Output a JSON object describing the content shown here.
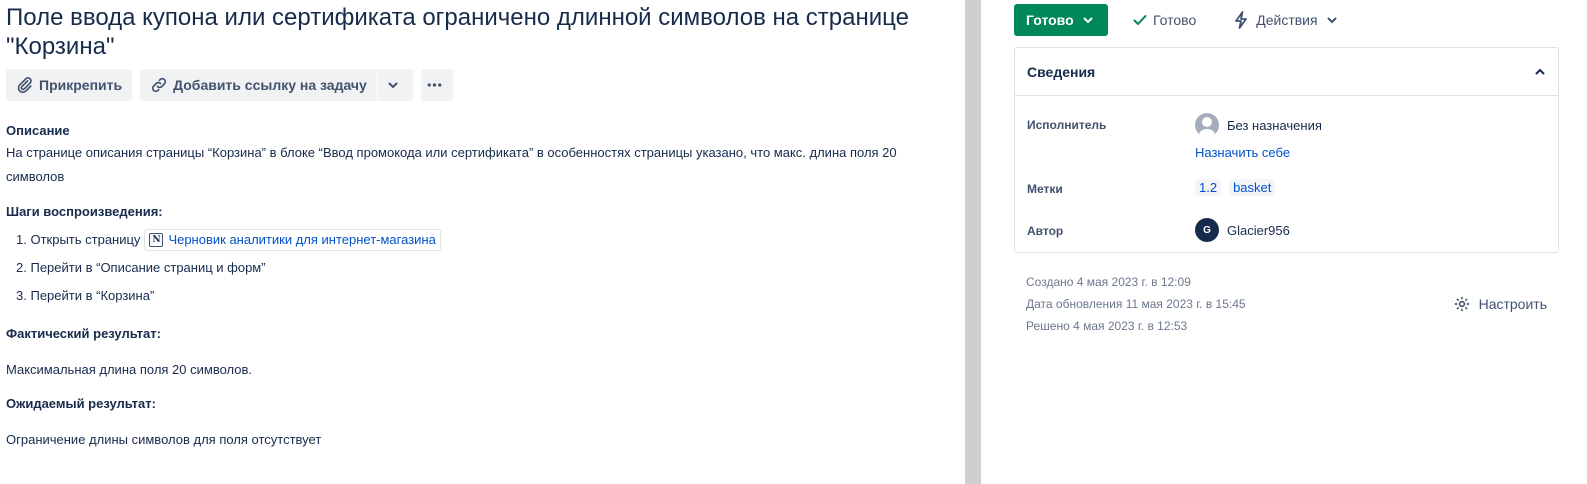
{
  "issue": {
    "title": "Поле ввода купона или сертификата ограничено длинной символов на странице \"Корзина\""
  },
  "toolbar": {
    "attach_label": "Прикрепить",
    "link_issue_label": "Добавить ссылку на задачу",
    "more_icon": "more-icon"
  },
  "description": {
    "label": "Описание",
    "text": "На странице описания страницы “Корзина” в блоке “Ввод промокода или сертификата” в особенностях страницы указано, что макс. длина поля 20 символов",
    "steps_heading": "Шаги воспроизведения:",
    "steps": [
      {
        "num": "1.",
        "text": "Открыть страницу",
        "link": "Черновик аналитики для интернет-магазина"
      },
      {
        "num": "2.",
        "text": "Перейти в “Описание страниц и форм”"
      },
      {
        "num": "3.",
        "text": "Перейти в “Корзина”"
      }
    ],
    "actual_heading": "Фактический результат:",
    "actual_text": "Максимальная длина поля 20 символов.",
    "expected_heading": "Ожидаемый результат:",
    "expected_text": "Ограничение длины символов для поля отсутствует"
  },
  "status": {
    "button_label": "Готово",
    "resolution_label": "Готово",
    "actions_label": "Действия",
    "accent_color": "#00875a"
  },
  "details": {
    "title": "Сведения",
    "assignee_label": "Исполнитель",
    "assignee_value": "Без назначения",
    "assign_me": "Назначить себе",
    "labels_label": "Метки",
    "labels": [
      "1.2",
      "basket"
    ],
    "reporter_label": "Автор",
    "reporter_initial": "G",
    "reporter_name": "Glacier956"
  },
  "meta": {
    "created": "Создано 4 мая 2023 г. в 12:09",
    "updated": "Дата обновления 11 мая 2023 г. в 15:45",
    "resolved": "Решено 4 мая 2023 г. в 12:53",
    "configure_label": "Настроить"
  }
}
